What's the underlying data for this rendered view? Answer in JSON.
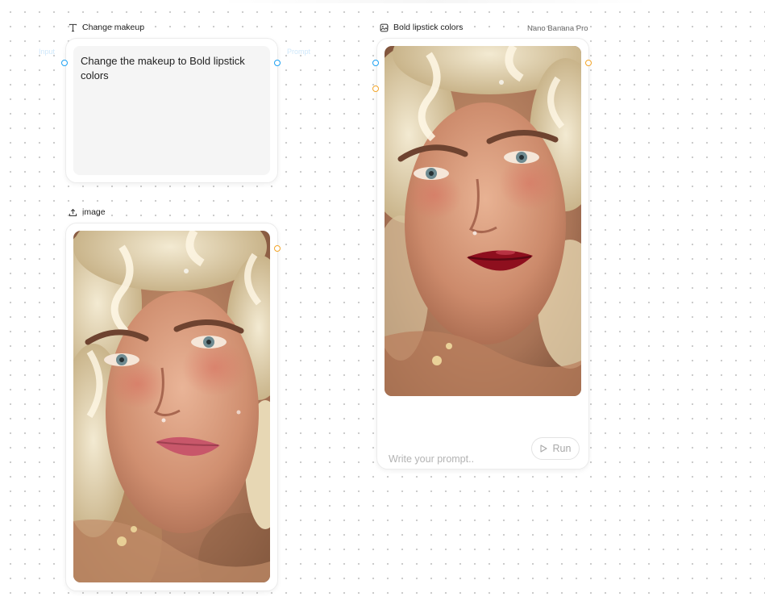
{
  "canvas": {
    "grid_dot_color": "#c9c9c9",
    "port_colors": {
      "text": "#1ea1f2",
      "image": "#f2a52a"
    }
  },
  "text_node": {
    "title": "Change makeup",
    "icon": "text-type-icon",
    "content": "Change the makeup to Bold lipstick colors",
    "ghost_input": "Input",
    "ghost_output": "Prompt"
  },
  "image_node": {
    "title": "image",
    "icon": "upload-icon"
  },
  "generate_node": {
    "title": "Bold lipstick colors",
    "icon": "image-icon",
    "model": "Nano Banana Pro",
    "prompt_placeholder": "Write your prompt..",
    "prompt_value": "",
    "run_label": "Run",
    "run_icon": "play-icon"
  }
}
